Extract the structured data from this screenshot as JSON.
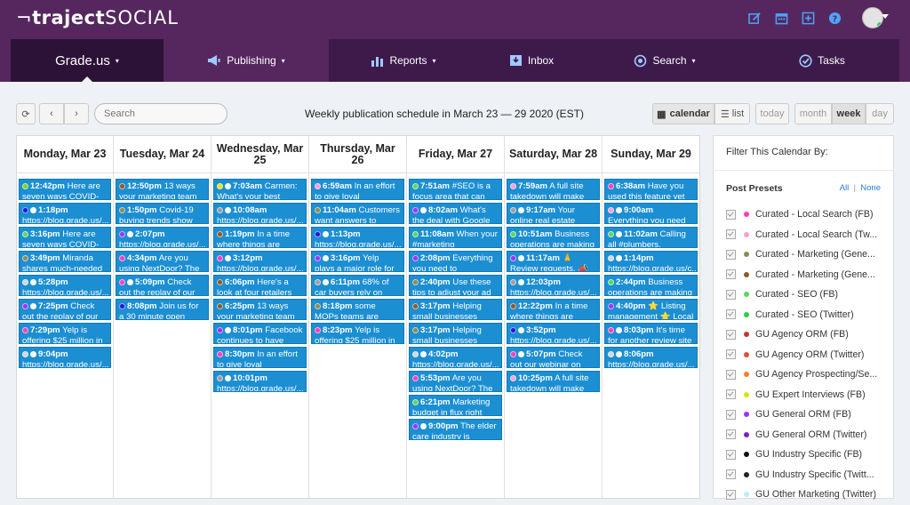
{
  "app": {
    "logo_bold": "traject",
    "logo_thin": "SOCIAL",
    "logo_mark": "¬"
  },
  "nav": {
    "brand": "Grade.us",
    "publishing": "Publishing",
    "reports": "Reports",
    "inbox": "Inbox",
    "search": "Search",
    "tasks": "Tasks"
  },
  "toolbar": {
    "search_placeholder": "Search",
    "title": "Weekly publication schedule in March 23 — 29 2020 (EST)",
    "calendar": "calendar",
    "list": "list",
    "today": "today",
    "month": "month",
    "week": "week",
    "day": "day"
  },
  "colors": {
    "accent": "#55275e",
    "event": "#1c8fd3"
  },
  "days": [
    {
      "label": "Monday, Mar 23",
      "events": [
        {
          "time": "12:42pm",
          "text": "Here are seven ways COVID-19",
          "color": "#7ed321",
          "check": false
        },
        {
          "time": "1:18pm",
          "text": "https://blog.grade.us/...",
          "color": "#1a1adb",
          "check": true
        },
        {
          "time": "3:16pm",
          "text": "Here are seven ways COVID-19",
          "color": "#5cd65c",
          "check": false
        },
        {
          "time": "3:49pm",
          "text": "Miranda shares much-needed",
          "color": "#8b8b55",
          "check": false
        },
        {
          "time": "5:28pm",
          "text": "https://blog.grade.us/...",
          "color": "#cfd8dc",
          "check": true
        },
        {
          "time": "7:25pm",
          "text": "Check out the replay of our",
          "color": "#9b30ff",
          "check": true
        },
        {
          "time": "7:29pm",
          "text": "Yelp is offering $25 million in",
          "color": "#ff3db8",
          "check": false
        },
        {
          "time": "9:04pm",
          "text": "https://blog.grade.us/...",
          "color": "#cfd8dc",
          "check": true
        }
      ]
    },
    {
      "label": "Tuesday, Mar 24",
      "events": [
        {
          "time": "12:50pm",
          "text": "13 ways your marketing team",
          "color": "#8b5a2b",
          "check": false
        },
        {
          "time": "1:50pm",
          "text": "Covid-19 buying trends show",
          "color": "#8b8b55",
          "check": false
        },
        {
          "time": "2:07pm",
          "text": "https://blog.grade.us/...",
          "color": "#9b30ff",
          "check": true
        },
        {
          "time": "4:34pm",
          "text": "Are you using NextDoor? The",
          "color": "#ff3db8",
          "check": false
        },
        {
          "time": "5:09pm",
          "text": "Check out the replay of our",
          "color": "#ff3db8",
          "check": true
        },
        {
          "time": "8:08pm",
          "text": "Join us for a 30 minute open",
          "color": "#1a1adb",
          "check": false
        }
      ]
    },
    {
      "label": "Wednesday, Mar 25",
      "events": [
        {
          "time": "7:03am",
          "text": "Carmen: What's your best advice",
          "color": "#e6e600",
          "check": true
        },
        {
          "time": "10:08am",
          "text": "https://blog.grade.us/...",
          "color": "#9e9e9e",
          "check": true
        },
        {
          "time": "1:19pm",
          "text": "In a time where things are",
          "color": "#8b5a2b",
          "check": false
        },
        {
          "time": "3:12pm",
          "text": "https://blog.grade.us/...",
          "color": "#ff3db8",
          "check": true
        },
        {
          "time": "6:06pm",
          "text": "Here's a look at four retailers",
          "color": "#8b5a2b",
          "check": false
        },
        {
          "time": "6:25pm",
          "text": "13 ways your marketing team",
          "color": "#8b5a2b",
          "check": false
        },
        {
          "time": "8:01pm",
          "text": "Facebook continues to have",
          "color": "#9b30ff",
          "check": true
        },
        {
          "time": "8:30pm",
          "text": "In an effort to give loyal customers",
          "color": "#ff3db8",
          "check": false
        },
        {
          "time": "10:01pm",
          "text": "https://blog.grade.us/...",
          "color": "#9e9e9e",
          "check": true
        }
      ]
    },
    {
      "label": "Thursday, Mar 26",
      "events": [
        {
          "time": "6:59am",
          "text": "In an effort to give loyal customers",
          "color": "#ff9ed8",
          "check": false
        },
        {
          "time": "11:04am",
          "text": "Customers want answers to",
          "color": "#8b8b55",
          "check": false
        },
        {
          "time": "1:13pm",
          "text": "https://blog.grade.us/...",
          "color": "#1a1adb",
          "check": true
        },
        {
          "time": "3:16pm",
          "text": "Yelp plays a major role for local",
          "color": "#9b30ff",
          "check": true
        },
        {
          "time": "6:11pm",
          "text": "68% of car buyers rely on",
          "color": "#9e9e9e",
          "check": true
        },
        {
          "time": "8:18pm",
          "text": "some MOPs teams are having to",
          "color": "#8b8b55",
          "check": false
        },
        {
          "time": "8:23pm",
          "text": "Yelp is offering $25 million in",
          "color": "#ff3db8",
          "check": false
        }
      ]
    },
    {
      "label": "Friday, Mar 27",
      "events": [
        {
          "time": "7:51am",
          "text": "#SEO is a focus area that can",
          "color": "#5cd65c",
          "check": false
        },
        {
          "time": "8:02am",
          "text": "What's the deal with Google",
          "color": "#9b30ff",
          "check": true
        },
        {
          "time": "11:08am",
          "text": "When your #marketing",
          "color": "#5cd65c",
          "check": false
        },
        {
          "time": "2:08pm",
          "text": "Everything you need to",
          "color": "#9b30ff",
          "check": false
        },
        {
          "time": "2:40pm",
          "text": "Use these tips to adjust your ad",
          "color": "#8b8b55",
          "check": false
        },
        {
          "time": "3:17pm",
          "text": "Helping small businesses",
          "color": "#8b5a2b",
          "check": false
        },
        {
          "time": "3:17pm",
          "text": "Helping small businesses",
          "color": "#8b8b55",
          "check": false
        },
        {
          "time": "4:02pm",
          "text": "https://blog.grade.us/...",
          "color": "#cfd8dc",
          "check": true
        },
        {
          "time": "5:53pm",
          "text": "Are you using NextDoor? The",
          "color": "#ff3db8",
          "check": false
        },
        {
          "time": "6:21pm",
          "text": "Marketing budget in flux right",
          "color": "#5cd65c",
          "check": false
        },
        {
          "time": "9:00pm",
          "text": "The elder care industry is blasting",
          "color": "#9b30ff",
          "check": true
        }
      ]
    },
    {
      "label": "Saturday, Mar 28",
      "events": [
        {
          "time": "7:59am",
          "text": "A full site takedown will make",
          "color": "#ff9ed8",
          "check": false
        },
        {
          "time": "9:17am",
          "text": "Your online real estate",
          "color": "#9e9e9e",
          "check": true
        },
        {
          "time": "10:51am",
          "text": "Business operations are making",
          "color": "#5cd65c",
          "check": false
        },
        {
          "time": "11:17am",
          "text": "🙏 Review requests. 📣",
          "color": "#9b30ff",
          "check": true
        },
        {
          "time": "12:03pm",
          "text": "https://blog.grade.us/...",
          "color": "#9e9e9e",
          "check": true
        },
        {
          "time": "12:22pm",
          "text": "In a time where things are",
          "color": "#8b5a2b",
          "check": false
        },
        {
          "time": "3:52pm",
          "text": "https://blog.grade.us/...",
          "color": "#1a1adb",
          "check": true
        },
        {
          "time": "5:07pm",
          "text": "Check out our webinar on how to",
          "color": "#ff3db8",
          "check": true
        },
        {
          "time": "10:25pm",
          "text": "A full site takedown will make",
          "color": "#ff9ed8",
          "check": false
        }
      ]
    },
    {
      "label": "Sunday, Mar 29",
      "events": [
        {
          "time": "6:38am",
          "text": "Have you used this feature yet",
          "color": "#ff3db8",
          "check": false
        },
        {
          "time": "9:00am",
          "text": "Everything you need to put together",
          "color": "#ff9ed8",
          "check": true
        },
        {
          "time": "11:02am",
          "text": "Calling all #plumbers, #roofers,",
          "color": "#5cd65c",
          "check": true
        },
        {
          "time": "1:14pm",
          "text": "https://blog.grade.us/c...",
          "color": "#cfd8dc",
          "check": true
        },
        {
          "time": "2:44pm",
          "text": "Business operations are making",
          "color": "#5cd65c",
          "check": false
        },
        {
          "time": "4:40pm",
          "text": "⭐ Listing management ⭐ Local",
          "color": "#9b30ff",
          "check": false
        },
        {
          "time": "8:03pm",
          "text": "It's time for another review site",
          "color": "#ff3db8",
          "check": true
        },
        {
          "time": "8:06pm",
          "text": "https://blog.grade.us/...",
          "color": "#cfd8dc",
          "check": true
        }
      ]
    }
  ],
  "filter": {
    "title": "Filter This Calendar By:",
    "presets_label": "Post Presets",
    "all": "All",
    "none": "None",
    "presets": [
      {
        "label": "Curated - Local Search (FB)",
        "color": "#ff3db8"
      },
      {
        "label": "Curated - Local Search (Tw...",
        "color": "#ff9ed8"
      },
      {
        "label": "Curated - Marketing (Gene...",
        "color": "#8b8b55"
      },
      {
        "label": "Curated - Marketing (Gene...",
        "color": "#8b5a2b"
      },
      {
        "label": "Curated - SEO (FB)",
        "color": "#5cd65c"
      },
      {
        "label": "Curated - SEO (Twitter)",
        "color": "#2ecc40"
      },
      {
        "label": "GU Agency ORM (FB)",
        "color": "#c0392b"
      },
      {
        "label": "GU Agency ORM (Twitter)",
        "color": "#e74c3c"
      },
      {
        "label": "GU Agency Prospecting/Se...",
        "color": "#ff7f27"
      },
      {
        "label": "GU Expert Interviews (FB)",
        "color": "#d4e600"
      },
      {
        "label": "GU General ORM (FB)",
        "color": "#9b30ff"
      },
      {
        "label": "GU General ORM (Twitter)",
        "color": "#7a1fd1"
      },
      {
        "label": "GU Industry Specific (FB)",
        "color": "#111111"
      },
      {
        "label": "GU Industry Specific (Twitt...",
        "color": "#222222"
      },
      {
        "label": "GU Other Marketing (Twitter)",
        "color": "#bfe8ff"
      }
    ]
  }
}
